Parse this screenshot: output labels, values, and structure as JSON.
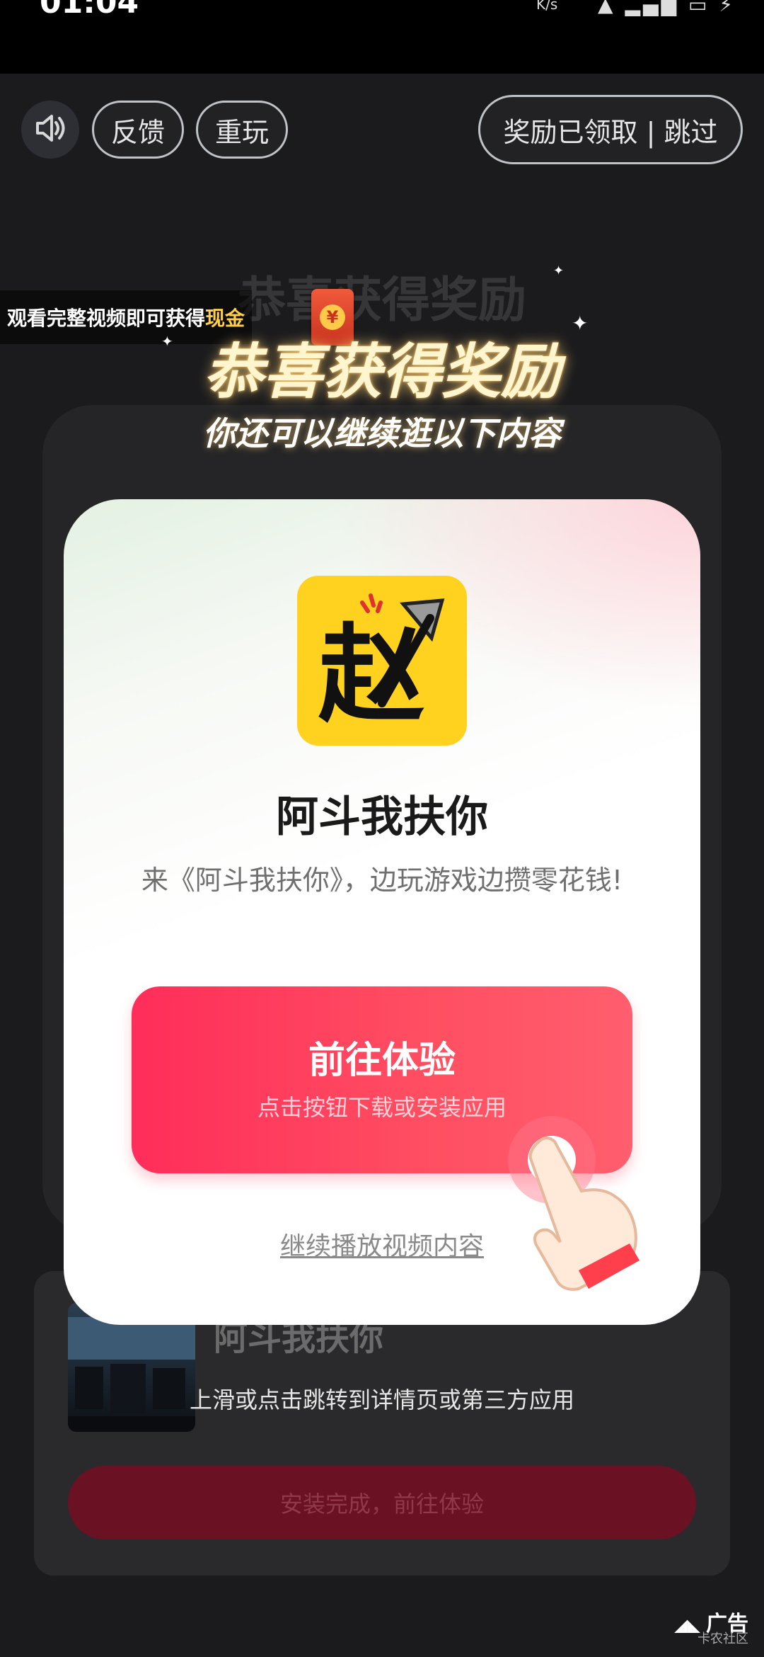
{
  "status_bar": {
    "time": "01:04",
    "speed": "K/s",
    "right": "▲ ▂▄▆ ▭ ⚡"
  },
  "top_bar": {
    "feedback_label": "反馈",
    "replay_label": "重玩",
    "reward_skip_label": "奖励已领取 | 跳过"
  },
  "banner": {
    "text_main": "观看完整视频即可获得",
    "text_gold": "现金",
    "coin": "¥"
  },
  "congrats": {
    "title": "恭喜获得奖励",
    "ghost_title": "恭喜获得奖励",
    "subtitle": "你还可以继续逛以下内容"
  },
  "modal": {
    "app_name": "阿斗我扶你",
    "description": "来《阿斗我扶你》，边玩游戏边攒零花钱!",
    "go_button_label": "前往体验",
    "go_button_sub": "点击按钮下载或安装应用",
    "continue_link": "继续播放视频内容",
    "icon_char": "赵"
  },
  "background_card": {
    "title": "阿斗我扶你",
    "description": "上滑或点击跳转到详情页或第三方应用",
    "install_button": "安装完成，前往体验"
  },
  "ad": {
    "label": "广告",
    "watermark": "卡农社区"
  },
  "colors": {
    "accent": "#ff2d5a",
    "icon_bg": "#ffd21f",
    "gold": "#ffcf4a"
  }
}
